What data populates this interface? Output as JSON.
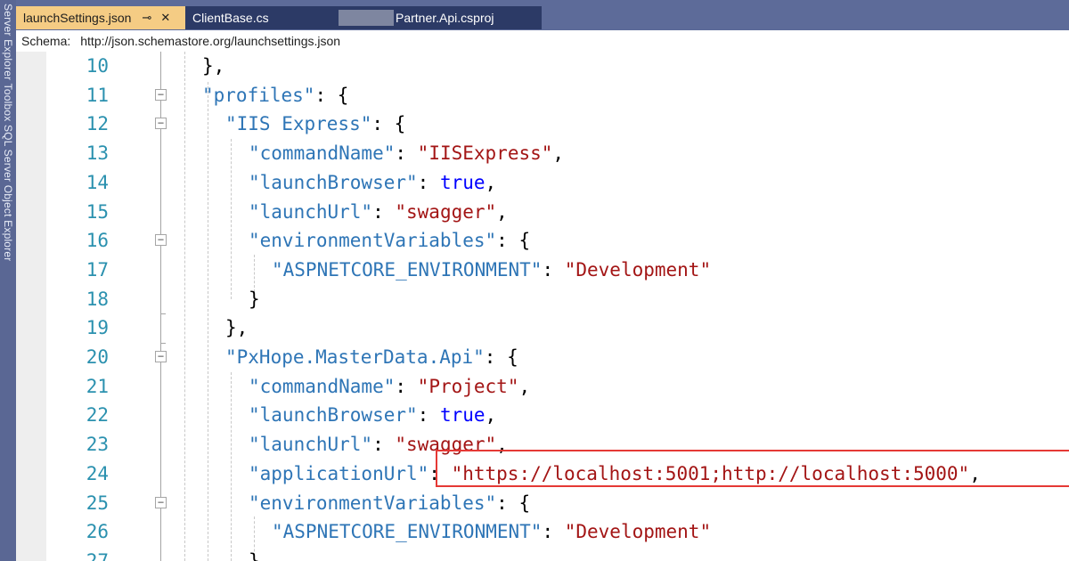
{
  "side_panel": {
    "text": "Server Explorer  Toolbox  SQL Server Object Explorer"
  },
  "tabs": [
    {
      "label": "launchSettings.json",
      "pin_icon": "pin-icon",
      "close_icon": "close-icon",
      "active": true
    },
    {
      "label": "ClientBase.cs",
      "active": false
    },
    {
      "label": "Partner.Api.csproj",
      "active": false
    }
  ],
  "schema": {
    "label": "Schema:",
    "url": "http://json.schemastore.org/launchsettings.json"
  },
  "colors": {
    "tab_active": "#f5cc84",
    "tab_inactive": "#2c3a66",
    "tab_bar": "#5d6b99",
    "line_number": "#2b91af",
    "json_key": "#2e75b6",
    "json_string": "#a31515",
    "json_keyword": "#0000ff",
    "highlight_box": "#e53935"
  },
  "lines": [
    {
      "num": "10",
      "fold": false,
      "code": [
        {
          "t": "p",
          "v": "},"
        }
      ]
    },
    {
      "num": "11",
      "fold": true,
      "code": [
        {
          "t": "k",
          "v": "\"profiles\""
        },
        {
          "t": "p",
          "v": ": {"
        }
      ]
    },
    {
      "num": "12",
      "fold": true,
      "code": [
        {
          "t": "k",
          "v": "\"IIS Express\""
        },
        {
          "t": "p",
          "v": ": {"
        }
      ]
    },
    {
      "num": "13",
      "fold": false,
      "code": [
        {
          "t": "k",
          "v": "\"commandName\""
        },
        {
          "t": "p",
          "v": ": "
        },
        {
          "t": "s",
          "v": "\"IISExpress\""
        },
        {
          "t": "p",
          "v": ","
        }
      ]
    },
    {
      "num": "14",
      "fold": false,
      "code": [
        {
          "t": "k",
          "v": "\"launchBrowser\""
        },
        {
          "t": "p",
          "v": ": "
        },
        {
          "t": "b",
          "v": "true"
        },
        {
          "t": "p",
          "v": ","
        }
      ]
    },
    {
      "num": "15",
      "fold": false,
      "code": [
        {
          "t": "k",
          "v": "\"launchUrl\""
        },
        {
          "t": "p",
          "v": ": "
        },
        {
          "t": "s",
          "v": "\"swagger\""
        },
        {
          "t": "p",
          "v": ","
        }
      ]
    },
    {
      "num": "16",
      "fold": true,
      "code": [
        {
          "t": "k",
          "v": "\"environmentVariables\""
        },
        {
          "t": "p",
          "v": ": {"
        }
      ]
    },
    {
      "num": "17",
      "fold": false,
      "code": [
        {
          "t": "k",
          "v": "\"ASPNETCORE_ENVIRONMENT\""
        },
        {
          "t": "p",
          "v": ": "
        },
        {
          "t": "s",
          "v": "\"Development\""
        }
      ]
    },
    {
      "num": "18",
      "fold": false,
      "code": [
        {
          "t": "p",
          "v": "}"
        }
      ]
    },
    {
      "num": "19",
      "fold": false,
      "code": [
        {
          "t": "p",
          "v": "},"
        }
      ]
    },
    {
      "num": "20",
      "fold": true,
      "code": [
        {
          "t": "k",
          "v": "\"PxHope.MasterData.Api\""
        },
        {
          "t": "p",
          "v": ": {"
        }
      ]
    },
    {
      "num": "21",
      "fold": false,
      "code": [
        {
          "t": "k",
          "v": "\"commandName\""
        },
        {
          "t": "p",
          "v": ": "
        },
        {
          "t": "s",
          "v": "\"Project\""
        },
        {
          "t": "p",
          "v": ","
        }
      ]
    },
    {
      "num": "22",
      "fold": false,
      "code": [
        {
          "t": "k",
          "v": "\"launchBrowser\""
        },
        {
          "t": "p",
          "v": ": "
        },
        {
          "t": "b",
          "v": "true"
        },
        {
          "t": "p",
          "v": ","
        }
      ]
    },
    {
      "num": "23",
      "fold": false,
      "code": [
        {
          "t": "k",
          "v": "\"launchUrl\""
        },
        {
          "t": "p",
          "v": ": "
        },
        {
          "t": "s",
          "v": "\"swagger\""
        },
        {
          "t": "p",
          "v": ","
        }
      ]
    },
    {
      "num": "24",
      "fold": false,
      "code": [
        {
          "t": "k",
          "v": "\"applicationUrl\""
        },
        {
          "t": "p",
          "v": ": "
        },
        {
          "t": "s",
          "v": "\"https://localhost:5001;http://localhost:5000\""
        },
        {
          "t": "p",
          "v": ","
        }
      ]
    },
    {
      "num": "25",
      "fold": true,
      "code": [
        {
          "t": "k",
          "v": "\"environmentVariables\""
        },
        {
          "t": "p",
          "v": ": {"
        }
      ]
    },
    {
      "num": "26",
      "fold": false,
      "code": [
        {
          "t": "k",
          "v": "\"ASPNETCORE_ENVIRONMENT\""
        },
        {
          "t": "p",
          "v": ": "
        },
        {
          "t": "s",
          "v": "\"Development\""
        }
      ]
    },
    {
      "num": "27",
      "fold": false,
      "code": [
        {
          "t": "p",
          "v": "}"
        }
      ]
    }
  ]
}
